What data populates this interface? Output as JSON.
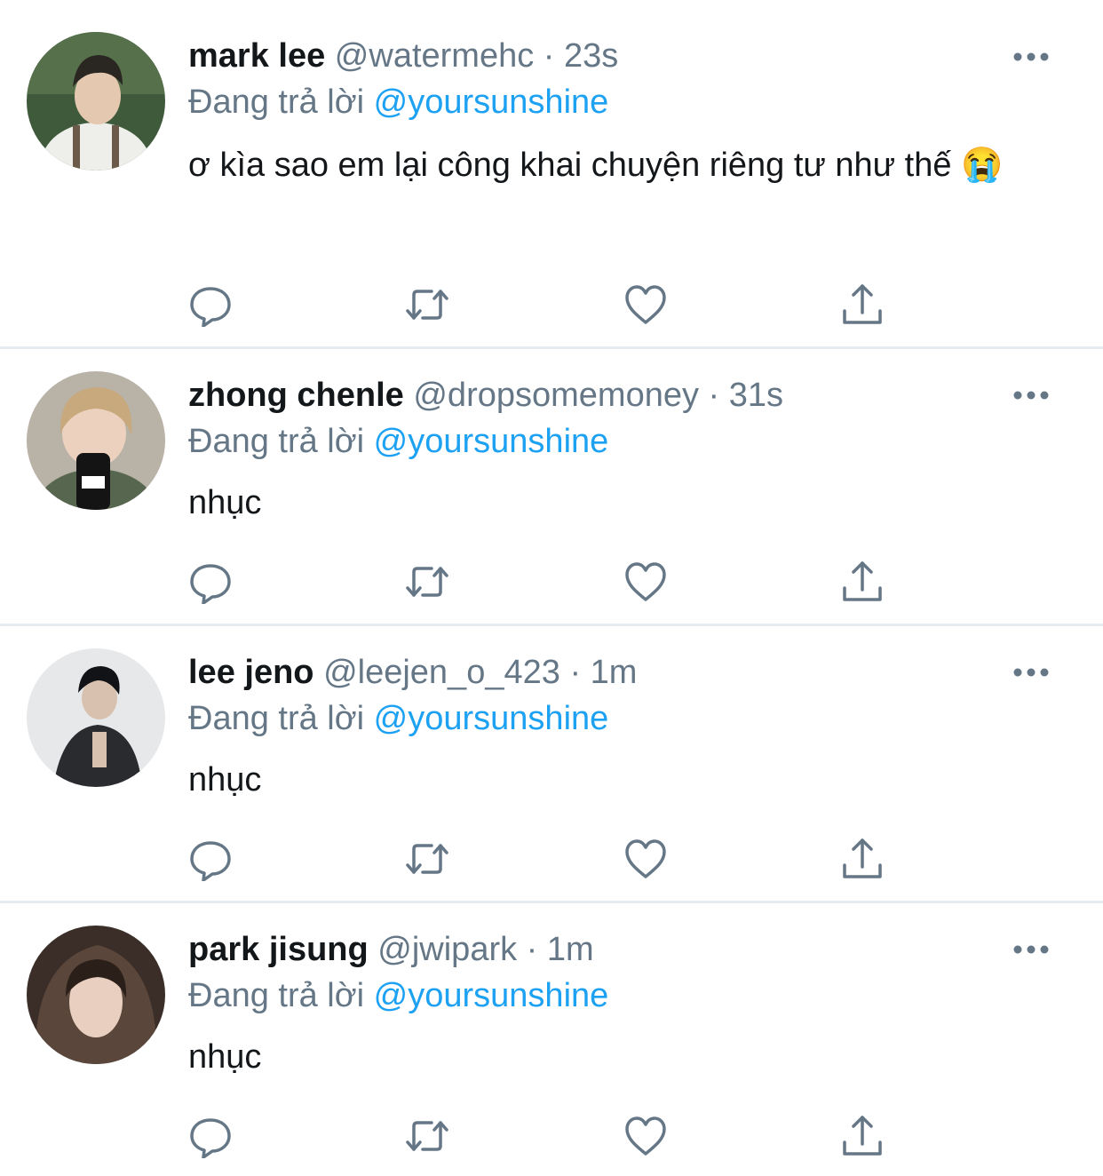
{
  "colors": {
    "accent": "#1da1f2",
    "secondary_text": "#657786",
    "primary_text": "#14171a",
    "divider": "#e6ecf0"
  },
  "tweets": [
    {
      "name": "mark lee",
      "handle": "@watermehc",
      "separator": "·",
      "time": "23s",
      "replying_label": "Đang trả lời",
      "replying_to": "@yoursunshine",
      "text": "ơ kìa sao em lại công khai chuyện riêng tư như thế 😭"
    },
    {
      "name": "zhong chenle",
      "handle": "@dropsomemoney",
      "separator": "·",
      "time": "31s",
      "replying_label": "Đang trả lời",
      "replying_to": "@yoursunshine",
      "text": "nhục"
    },
    {
      "name": "lee jeno",
      "handle": "@leejen_o_423",
      "separator": "·",
      "time": "1m",
      "replying_label": "Đang trả lời",
      "replying_to": "@yoursunshine",
      "text": "nhục"
    },
    {
      "name": "park jisung",
      "handle": "@jwipark",
      "separator": "·",
      "time": "1m",
      "replying_label": "Đang trả lời",
      "replying_to": "@yoursunshine",
      "text": "nhục"
    }
  ],
  "icons": {
    "reply": "reply-icon",
    "retweet": "retweet-icon",
    "like": "heart-icon",
    "share": "share-icon",
    "more": "more-icon"
  }
}
